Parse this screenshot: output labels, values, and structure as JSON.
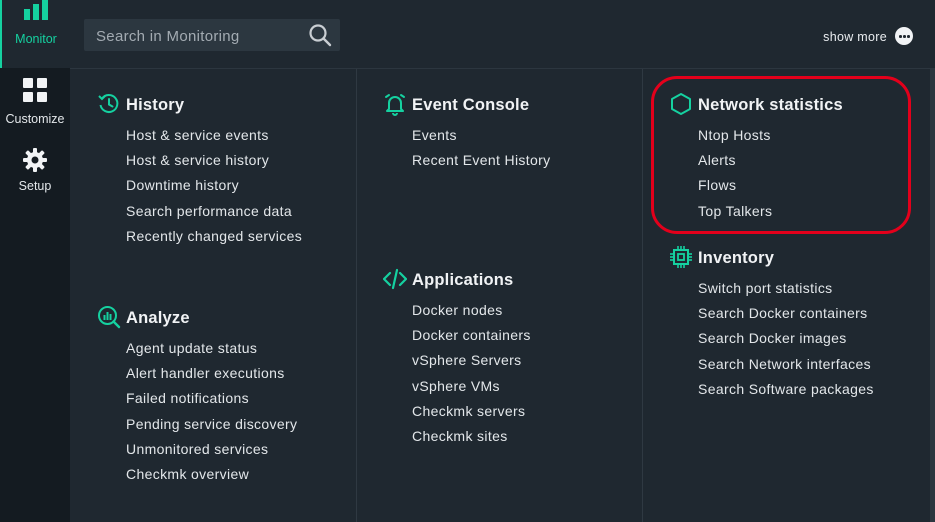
{
  "nav": {
    "monitor_label": "Monitor",
    "customize_label": "Customize",
    "setup_label": "Setup"
  },
  "search": {
    "placeholder": "Search in Monitoring",
    "value": ""
  },
  "show_more_label": "show more",
  "colors": {
    "accent": "#15d1a0",
    "highlight": "#e3001b",
    "background": "#1f2830",
    "sidebar": "#141b21"
  },
  "topics": {
    "history": {
      "icon": "history-icon",
      "title": "History",
      "items": [
        "Host & service events",
        "Host & service history",
        "Downtime history",
        "Search performance data",
        "Recently changed services"
      ]
    },
    "analyze": {
      "icon": "analyze-icon",
      "title": "Analyze",
      "items": [
        "Agent update status",
        "Alert handler executions",
        "Failed notifications",
        "Pending service discovery",
        "Unmonitored services",
        "Checkmk overview"
      ]
    },
    "event_console": {
      "icon": "bell-icon",
      "title": "Event Console",
      "items": [
        "Events",
        "Recent Event History"
      ]
    },
    "applications": {
      "icon": "code-icon",
      "title": "Applications",
      "items": [
        "Docker nodes",
        "Docker containers",
        "vSphere Servers",
        "vSphere VMs",
        "Checkmk servers",
        "Checkmk sites"
      ]
    },
    "network_statistics": {
      "icon": "hexagon-icon",
      "title": "Network statistics",
      "items": [
        "Ntop Hosts",
        "Alerts",
        "Flows",
        "Top Talkers"
      ]
    },
    "inventory": {
      "icon": "chip-icon",
      "title": "Inventory",
      "items": [
        "Switch port statistics",
        "Search Docker containers",
        "Search Docker images",
        "Search Network interfaces",
        "Search Software packages"
      ]
    }
  }
}
